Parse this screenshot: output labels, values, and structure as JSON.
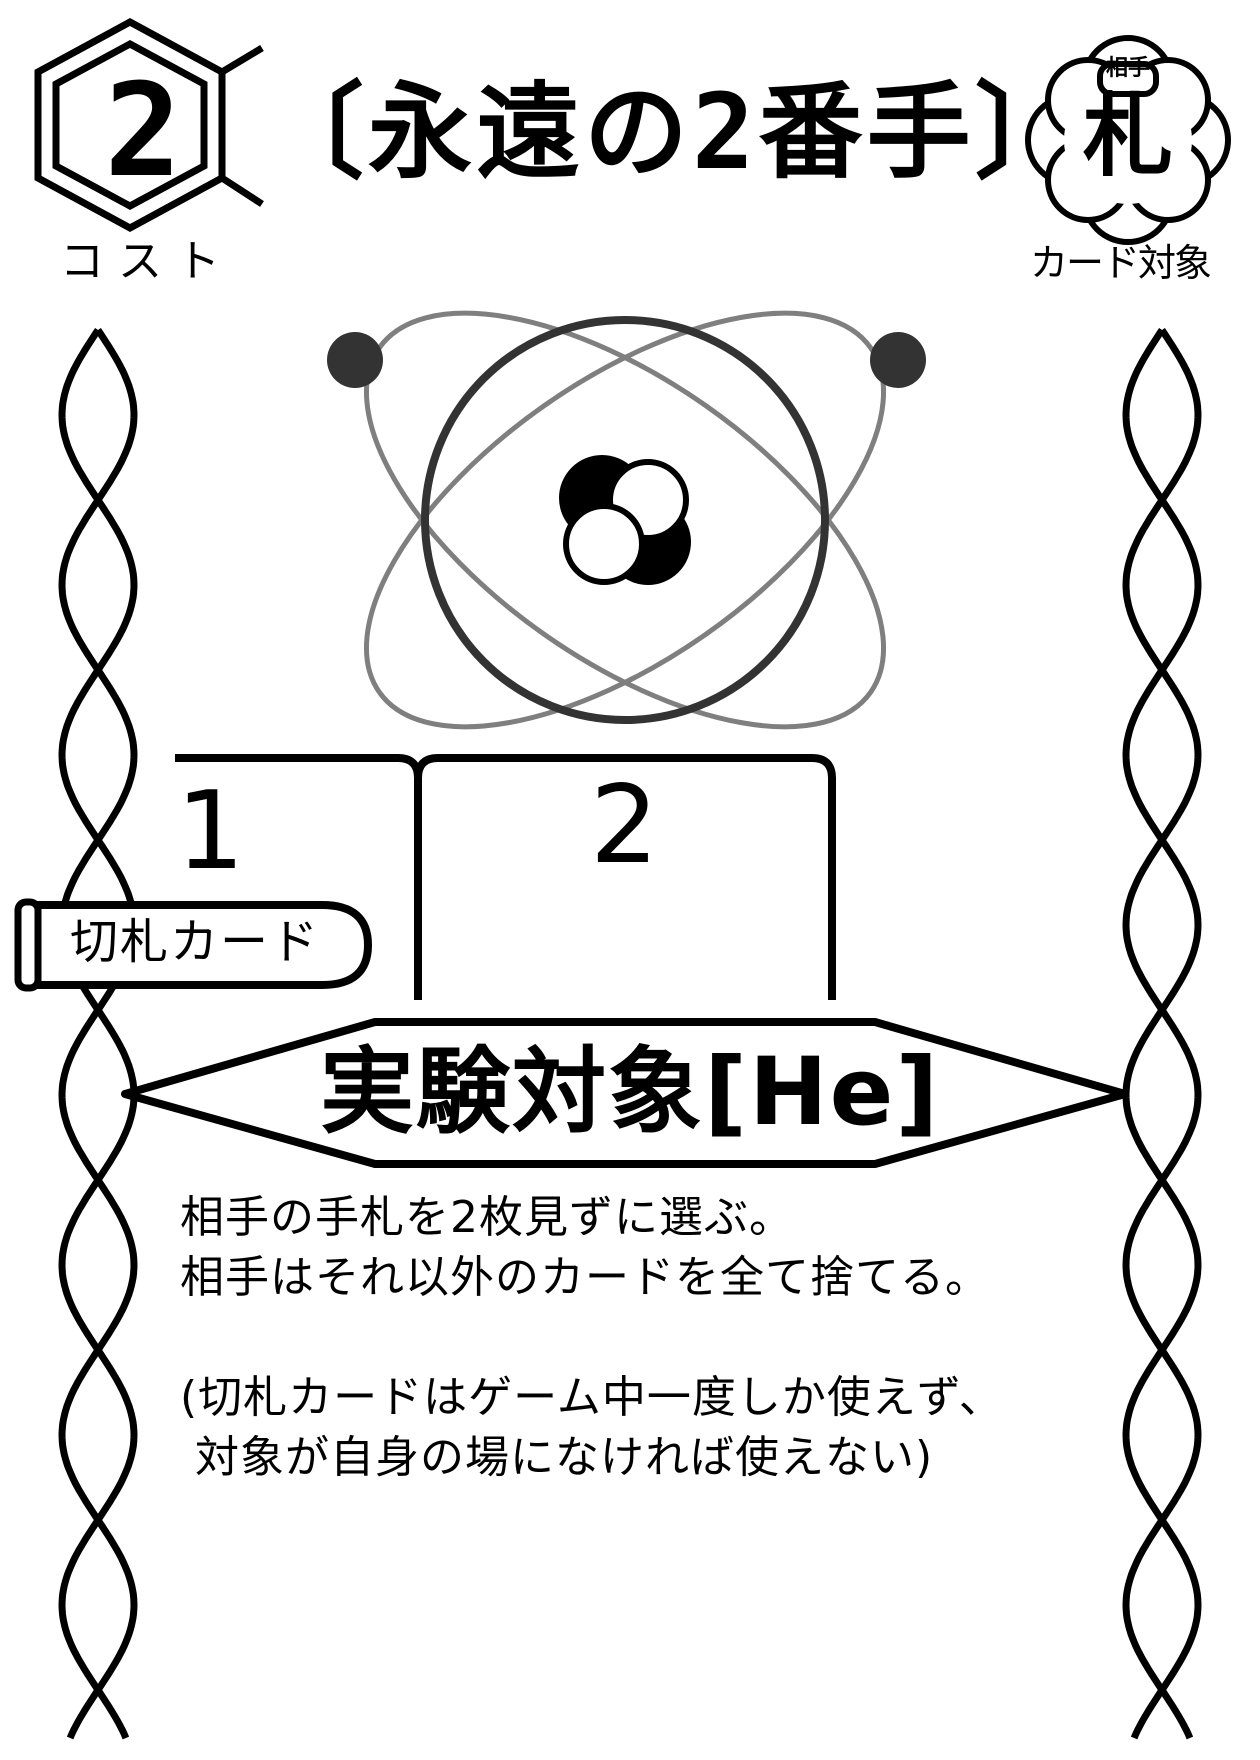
{
  "card": {
    "cost": {
      "value": "2",
      "label": "コスト"
    },
    "name": "〔永遠の2番手〕",
    "target_badge": {
      "top": "相手",
      "main": "札",
      "label": "カード対象"
    },
    "tabs": [
      {
        "label": "1"
      },
      {
        "label": "2"
      }
    ],
    "category": "切札カード",
    "banner": "実験対象[He]",
    "effect_lines": [
      "相手の手札を2枚見ずに選ぶ。",
      "相手はそれ以外のカードを全て捨てる。",
      "",
      "(切札カードはゲーム中一度しか使えず、",
      " 対象が自身の場になければ使えない)"
    ],
    "icons": {
      "cost": "hexagon-icon",
      "target": "flower-badge-icon",
      "art": "helium-atom-icon",
      "border": "helix-border-icon"
    },
    "colors": {
      "ink": "#000000",
      "paper": "#ffffff",
      "orbit": "#555555"
    }
  }
}
